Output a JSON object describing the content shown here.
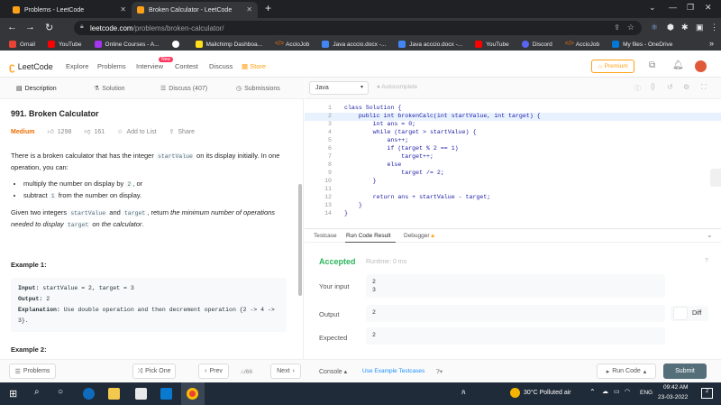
{
  "browser": {
    "tabs": [
      {
        "title": "Problems - LeetCode",
        "active": false
      },
      {
        "title": "Broken Calculator - LeetCode",
        "active": true
      }
    ],
    "url_host": "leetcode.com",
    "url_path": "/problems/broken-calculator/",
    "bookmarks": [
      {
        "label": "Gmail",
        "color": "#ea4335"
      },
      {
        "label": "YouTube",
        "color": "#ff0000"
      },
      {
        "label": "Online Courses - A...",
        "color": "#a435f0"
      },
      {
        "label": "",
        "color": "#ffffff"
      },
      {
        "label": "Mailchimp Dashboa...",
        "color": "#ffe01b"
      },
      {
        "label": "AccioJob",
        "color": "#e8710a"
      },
      {
        "label": "Java acccio.docx -...",
        "color": "#4285f4"
      },
      {
        "label": "Java acccio.docx -...",
        "color": "#4285f4"
      },
      {
        "label": "YouTube",
        "color": "#ff0000"
      },
      {
        "label": "Discord",
        "color": "#5865f2"
      },
      {
        "label": "AccioJob",
        "color": "#e8710a"
      },
      {
        "label": "My files - OneDrive",
        "color": "#0078d4"
      }
    ]
  },
  "nav": {
    "logo": "LeetCode",
    "links": [
      "Explore",
      "Problems",
      "Interview",
      "Contest",
      "Discuss",
      "Store"
    ],
    "new_badge": "New",
    "premium": "Premium"
  },
  "left": {
    "tabs": [
      "Description",
      "Solution",
      "Discuss (407)",
      "Submissions"
    ],
    "title": "991. Broken Calculator",
    "difficulty": "Medium",
    "likes": "1298",
    "dislikes": "161",
    "add_to_list": "Add to List",
    "share": "Share",
    "p1a": "There is a broken calculator that has the integer ",
    "p1code": "startValue",
    "p1b": " on its display initially. In one operation, you can:",
    "bullet1a": "multiply the number on display by ",
    "bullet1code": "2",
    "bullet1b": ", or",
    "bullet2a": "subtract ",
    "bullet2code": "1",
    "bullet2b": " from the number on display.",
    "p2a": "Given two integers ",
    "p2code1": "startValue",
    "p2b": " and ",
    "p2code2": "target",
    "p2c": ", return ",
    "p2em": "the minimum number of operations needed to display ",
    "p2code3": "target",
    "p2em2": " on the calculator",
    "p2d": ".",
    "example1_title": "Example 1:",
    "ex1_input_label": "Input:",
    "ex1_input": " startValue = 2, target = 3",
    "ex1_output_label": "Output:",
    "ex1_output": " 2",
    "ex1_expl_label": "Explanation:",
    "ex1_expl": " Use double operation and then decrement operation {2 -> 4 -> 3}.",
    "example2_title": "Example 2:"
  },
  "editor": {
    "language": "Java",
    "autocomplete": "Autocomplete",
    "lines": [
      "class Solution {",
      "    public int brokenCalc(int startValue, int target) {",
      "        int ans = 0;",
      "        while (target > startValue) {",
      "            ans++;",
      "            if (target % 2 == 1)",
      "                target++;",
      "            else",
      "                target /= 2;",
      "        }",
      "",
      "        return ans + startValue - target;",
      "    }",
      "}"
    ]
  },
  "console": {
    "tabs": [
      "Testcase",
      "Run Code Result",
      "Debugger"
    ],
    "status": "Accepted",
    "runtime": "Runtime: 0 ms",
    "your_input_label": "Your input",
    "your_input": [
      "2",
      "3"
    ],
    "output_label": "Output",
    "output": "2",
    "diff_label": "Diff",
    "expected_label": "Expected",
    "expected": "2"
  },
  "bottombar": {
    "problems": "Problems",
    "pick_one": "Pick One",
    "prev": "Prev",
    "page": "/66",
    "next": "Next",
    "console": "Console",
    "use_example": "Use Example Testcases",
    "run_code": "Run Code",
    "submit": "Submit"
  },
  "taskbar": {
    "weather": "30°C  Polluted air",
    "lang": "ENG",
    "time": "09:42 AM",
    "date": "23-03-2022"
  },
  "colors": {
    "accent_orange": "#ffa116",
    "medium": "#ef6c00",
    "accepted": "#2db55d",
    "link_blue": "#1a90ff",
    "submit": "#546e7a"
  }
}
